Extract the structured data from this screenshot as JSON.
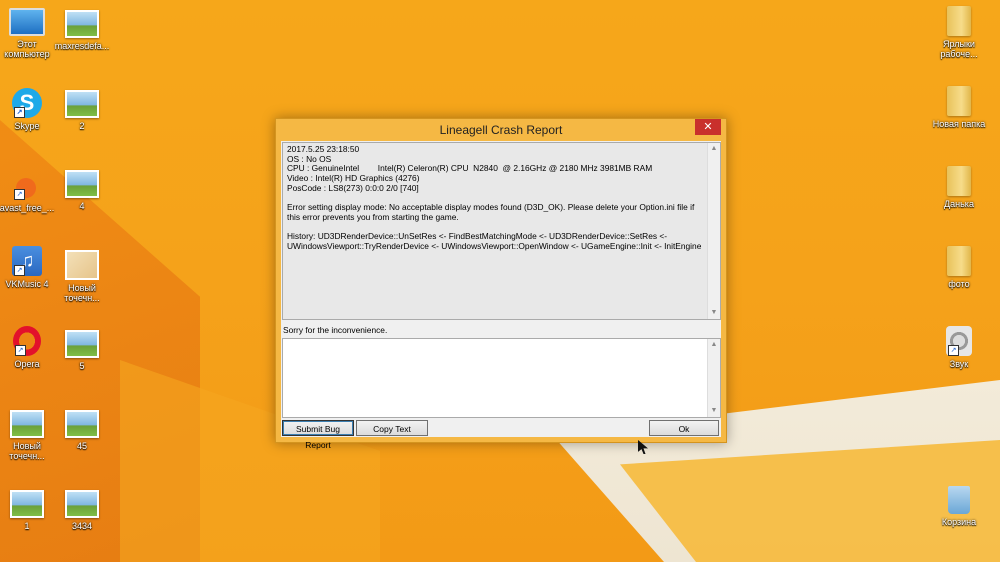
{
  "desktop": {
    "left_icons": [
      {
        "label": "Этот компьютер",
        "icon": "computer-icon"
      },
      {
        "label": "maxresdefa...",
        "icon": "image-file-icon"
      },
      {
        "label": "Skype",
        "icon": "skype-icon"
      },
      {
        "label": "2",
        "icon": "image-file-icon"
      },
      {
        "label": "avast_free_...",
        "icon": "avast-icon"
      },
      {
        "label": "4",
        "icon": "image-file-icon"
      },
      {
        "label": "VKMusic 4",
        "icon": "vkmusic-icon"
      },
      {
        "label": "Новый точечн...",
        "icon": "bitmap-file-icon"
      },
      {
        "label": "Opera",
        "icon": "opera-icon"
      },
      {
        "label": "5",
        "icon": "image-file-icon"
      },
      {
        "label": "Новый точечн...",
        "icon": "image-file-icon"
      },
      {
        "label": "45",
        "icon": "image-file-icon"
      },
      {
        "label": "1",
        "icon": "image-file-icon"
      },
      {
        "label": "3434",
        "icon": "image-file-icon"
      }
    ],
    "right_icons": [
      {
        "label": "Ярлыки рабоче...",
        "icon": "folder-icon"
      },
      {
        "label": "Новая папка",
        "icon": "folder-icon"
      },
      {
        "label": "Данька",
        "icon": "folder-icon"
      },
      {
        "label": "фото",
        "icon": "folder-icon"
      },
      {
        "label": "Звук",
        "icon": "speaker-icon"
      },
      {
        "label": "Корзина",
        "icon": "recycle-bin-icon"
      }
    ]
  },
  "dialog": {
    "title": "Lineagell Crash Report",
    "close_label": "✕",
    "report_text": "2017.5.25 23:18:50\nOS : No OS\nCPU : GenuineIntel        Intel(R) Celeron(R) CPU  N2840  @ 2.16GHz @ 2180 MHz 3981MB RAM\nVideo : Intel(R) HD Graphics (4276)\nPosCode : LS8(273) 0:0:0 2/0 [740]\n\nError setting display mode: No acceptable display modes found (D3D_OK). Please delete your Option.ini file if this error prevents you from starting the game.\n\nHistory: UD3DRenderDevice::UnSetRes <- FindBestMatchingMode <- UD3DRenderDevice::SetRes <- UWindowsViewport::TryRenderDevice <- UWindowsViewport::OpenWindow <- UGameEngine::Init <- InitEngine",
    "sorry_text": "Sorry for the inconvenience.",
    "comment_value": "",
    "buttons": {
      "submit": "Submit Bug Report",
      "copy": "Copy Text",
      "ok": "Ok"
    }
  }
}
